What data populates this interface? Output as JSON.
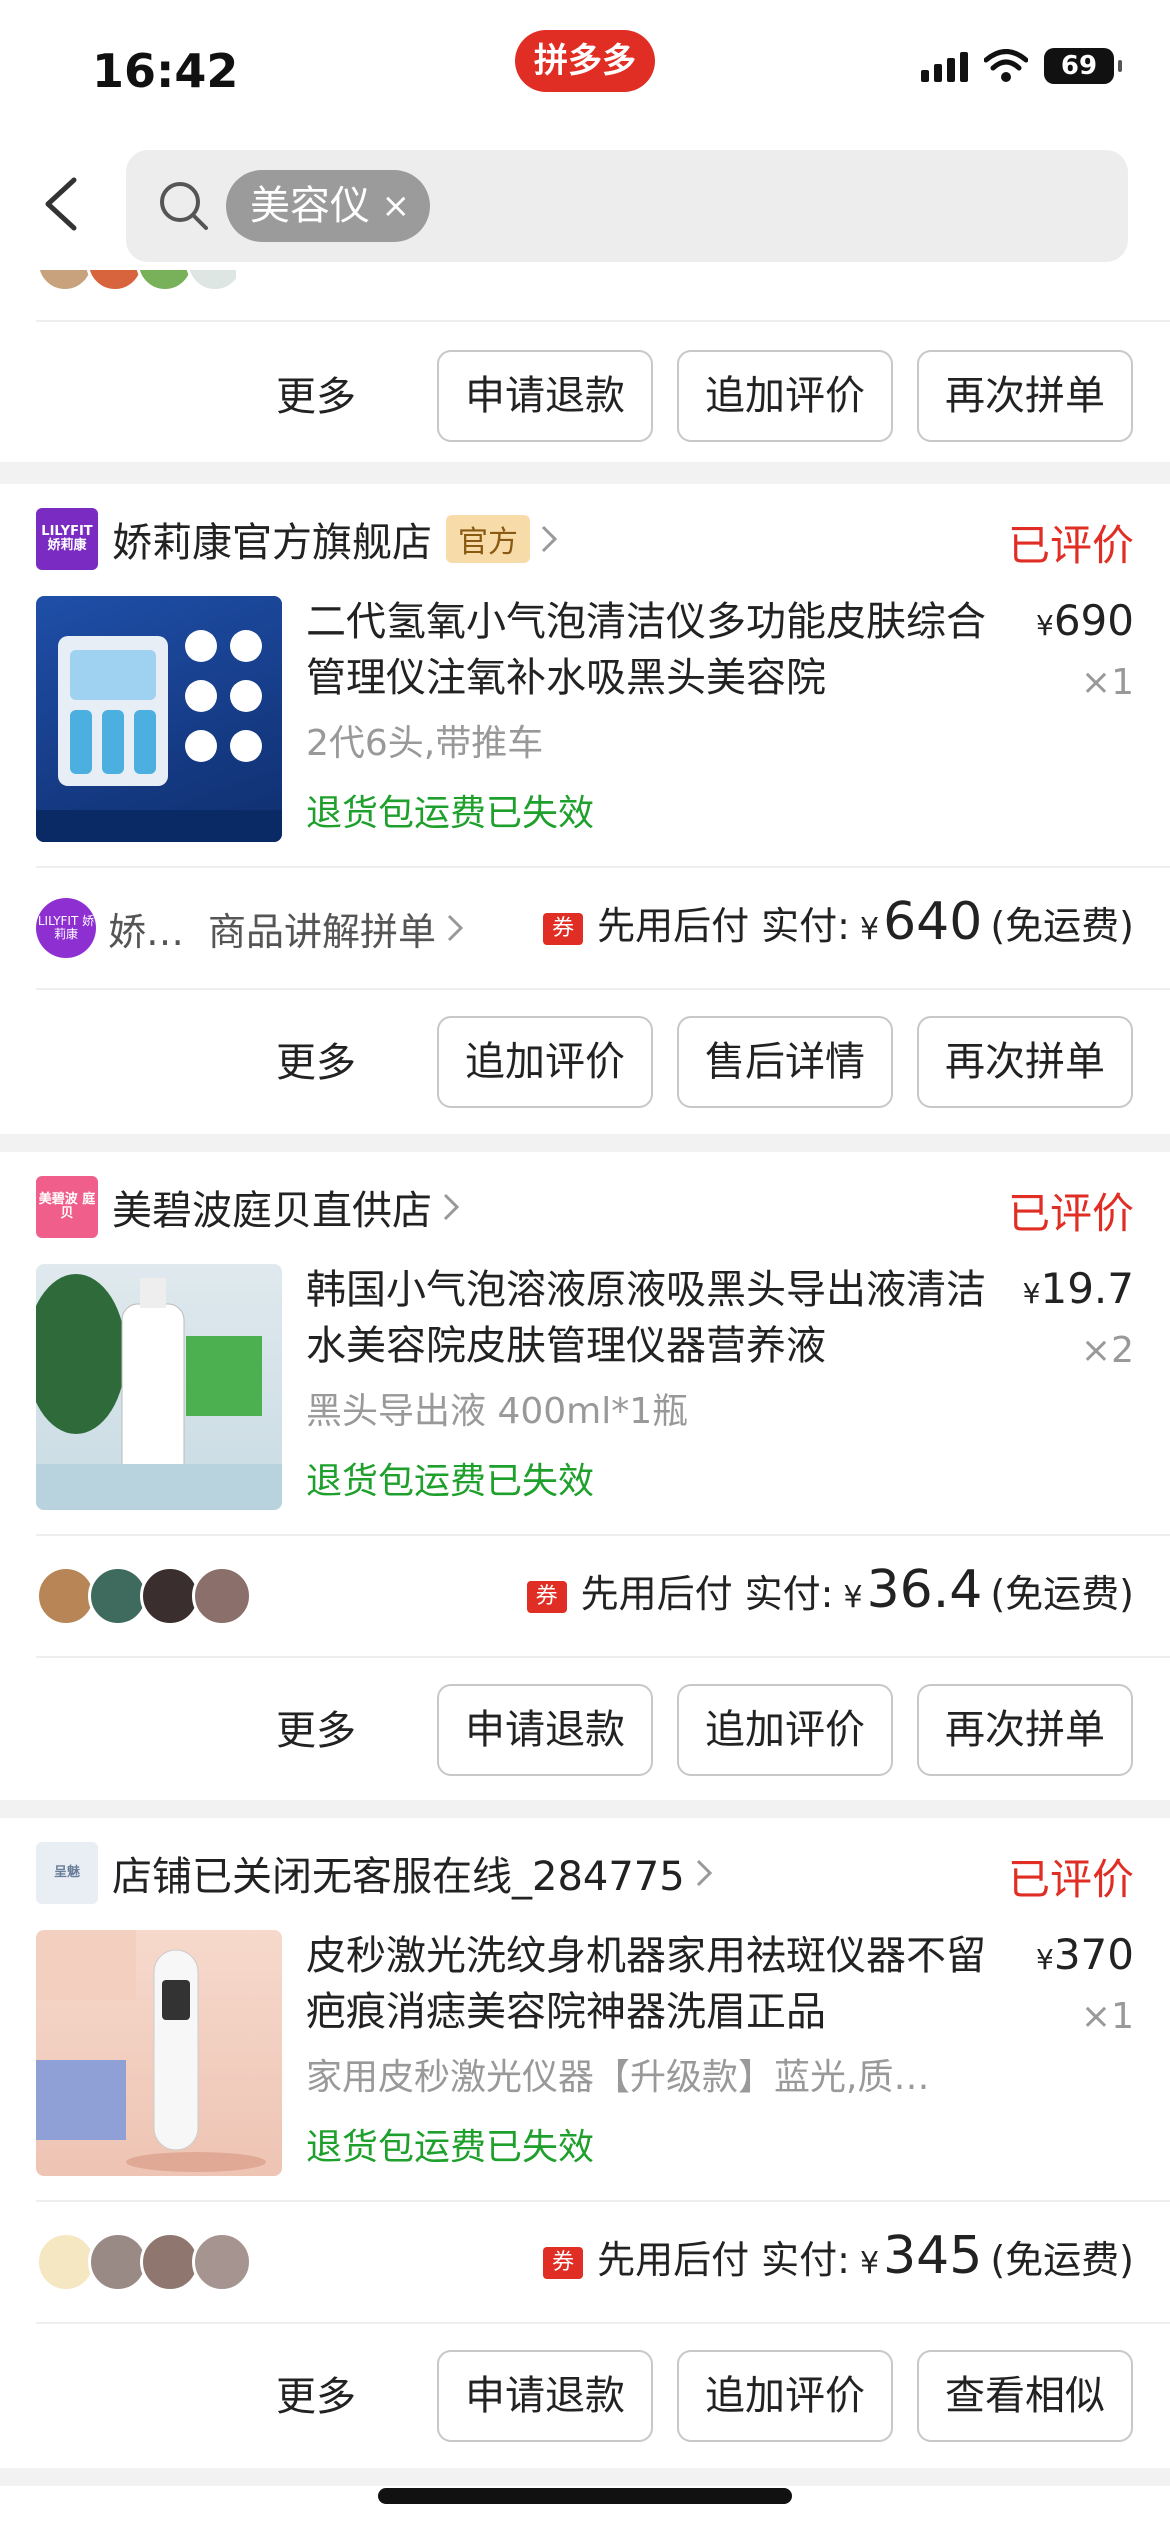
{
  "status_bar": {
    "time": "16:42",
    "brand": "拼多多",
    "battery": "69"
  },
  "search": {
    "keyword": "美容仪",
    "clear": "×"
  },
  "top_actions": {
    "more": "更多",
    "b1": "申请退款",
    "b2": "追加评价",
    "b3": "再次拼单"
  },
  "orders": [
    {
      "shop_logo": "LILYFIT 娇莉康",
      "shop_name": "娇莉康官方旗舰店",
      "badge": "官方",
      "status": "已评价",
      "title": "二代氢氧小气泡清洁仪多功能皮肤综合管理仪注氧补水吸黑头美容院",
      "spec": "2代6头,带推车",
      "notice": "退货包运费已失效",
      "price": "690",
      "qty": "×1",
      "shop_short": "娇…",
      "explain": "商品讲解拼单",
      "pay_label": "先用后付 实付:",
      "pay_amount": "640",
      "shipping": "(免运费)",
      "more": "更多",
      "b1": "追加评价",
      "b2": "售后详情",
      "b3": "再次拼单"
    },
    {
      "shop_logo": "美碧波 庭贝",
      "shop_name": "美碧波庭贝直供店",
      "status": "已评价",
      "title": "韩国小气泡溶液原液吸黑头导出液清洁水美容院皮肤管理仪器营养液",
      "spec": "黑头导出液 400ml*1瓶",
      "notice": "退货包运费已失效",
      "price": "19.7",
      "qty": "×2",
      "pay_label": "先用后付 实付:",
      "pay_amount": "36.4",
      "shipping": "(免运费)",
      "more": "更多",
      "b1": "申请退款",
      "b2": "追加评价",
      "b3": "再次拼单"
    },
    {
      "shop_logo": "呈魅",
      "shop_name": "店铺已关闭无客服在线_284775",
      "status": "已评价",
      "title": "皮秒激光洗纹身机器家用祛斑仪器不留疤痕消痣美容院神器洗眉正品",
      "spec": "家用皮秒激光仪器【升级款】蓝光,质…",
      "notice": "退货包运费已失效",
      "price": "370",
      "qty": "×1",
      "pay_label": "先用后付 实付:",
      "pay_amount": "345",
      "shipping": "(免运费)",
      "more": "更多",
      "b1": "申请退款",
      "b2": "追加评价",
      "b3": "查看相似"
    }
  ],
  "currency": "¥",
  "coupon_tag": "券",
  "colors": {
    "brand_red": "#e02e24",
    "green": "#1fa02c",
    "official_bg": "#f7dcaa"
  }
}
